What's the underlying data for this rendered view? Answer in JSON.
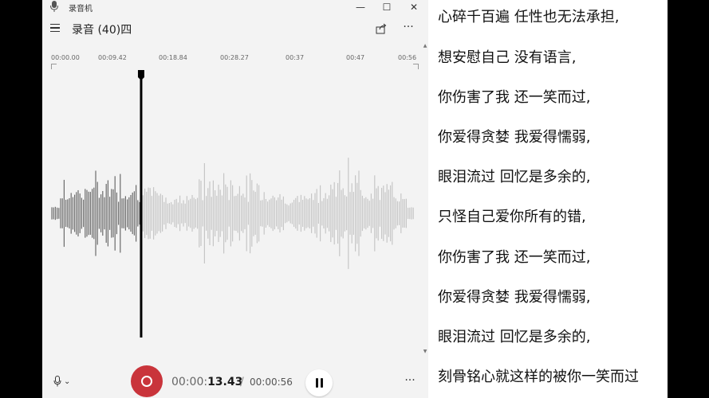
{
  "window": {
    "app_title": "录音机",
    "recording_title": "录音 (40)四",
    "minimize_glyph": "—",
    "maximize_glyph": "☐",
    "close_glyph": "✕"
  },
  "toolbar": {
    "menu_icon": "hamburger-icon",
    "share_icon": "share-icon",
    "more_glyph": "···"
  },
  "timeline": {
    "labels": [
      "00:00.00",
      "00:09.42",
      "00:18.84",
      "00:28.27",
      "00:37",
      "00:47",
      "00:56"
    ]
  },
  "playback": {
    "position_fraction": 0.24,
    "current_prefix": "00:00:",
    "current_seconds": "13.43",
    "separator": "/",
    "total": "00:00:56"
  },
  "bottombar": {
    "mic_icon": "microphone-icon",
    "chevron_glyph": "⌄",
    "record_icon": "record-icon",
    "pause_icon": "pause-icon",
    "more_glyph": "···"
  },
  "lyrics": [
    "心碎千百遍 任性也无法承担,",
    "想安慰自己 没有语言,",
    "你伤害了我 还一笑而过,",
    "你爱得贪婪 我爱得懦弱,",
    "眼泪流过 回忆是多余的,",
    "只怪自己爱你所有的错,",
    "你伤害了我 还一笑而过,",
    "你爱得贪婪 我爱得懦弱,",
    "眼泪流过 回忆是多余的,",
    "刻骨铭心就这样的被你一笑而过"
  ],
  "colors": {
    "record_red": "#c9343b",
    "played_wave": "#6b6b6b",
    "unplayed_wave": "#c6c6c6",
    "playhead": "#000000"
  }
}
